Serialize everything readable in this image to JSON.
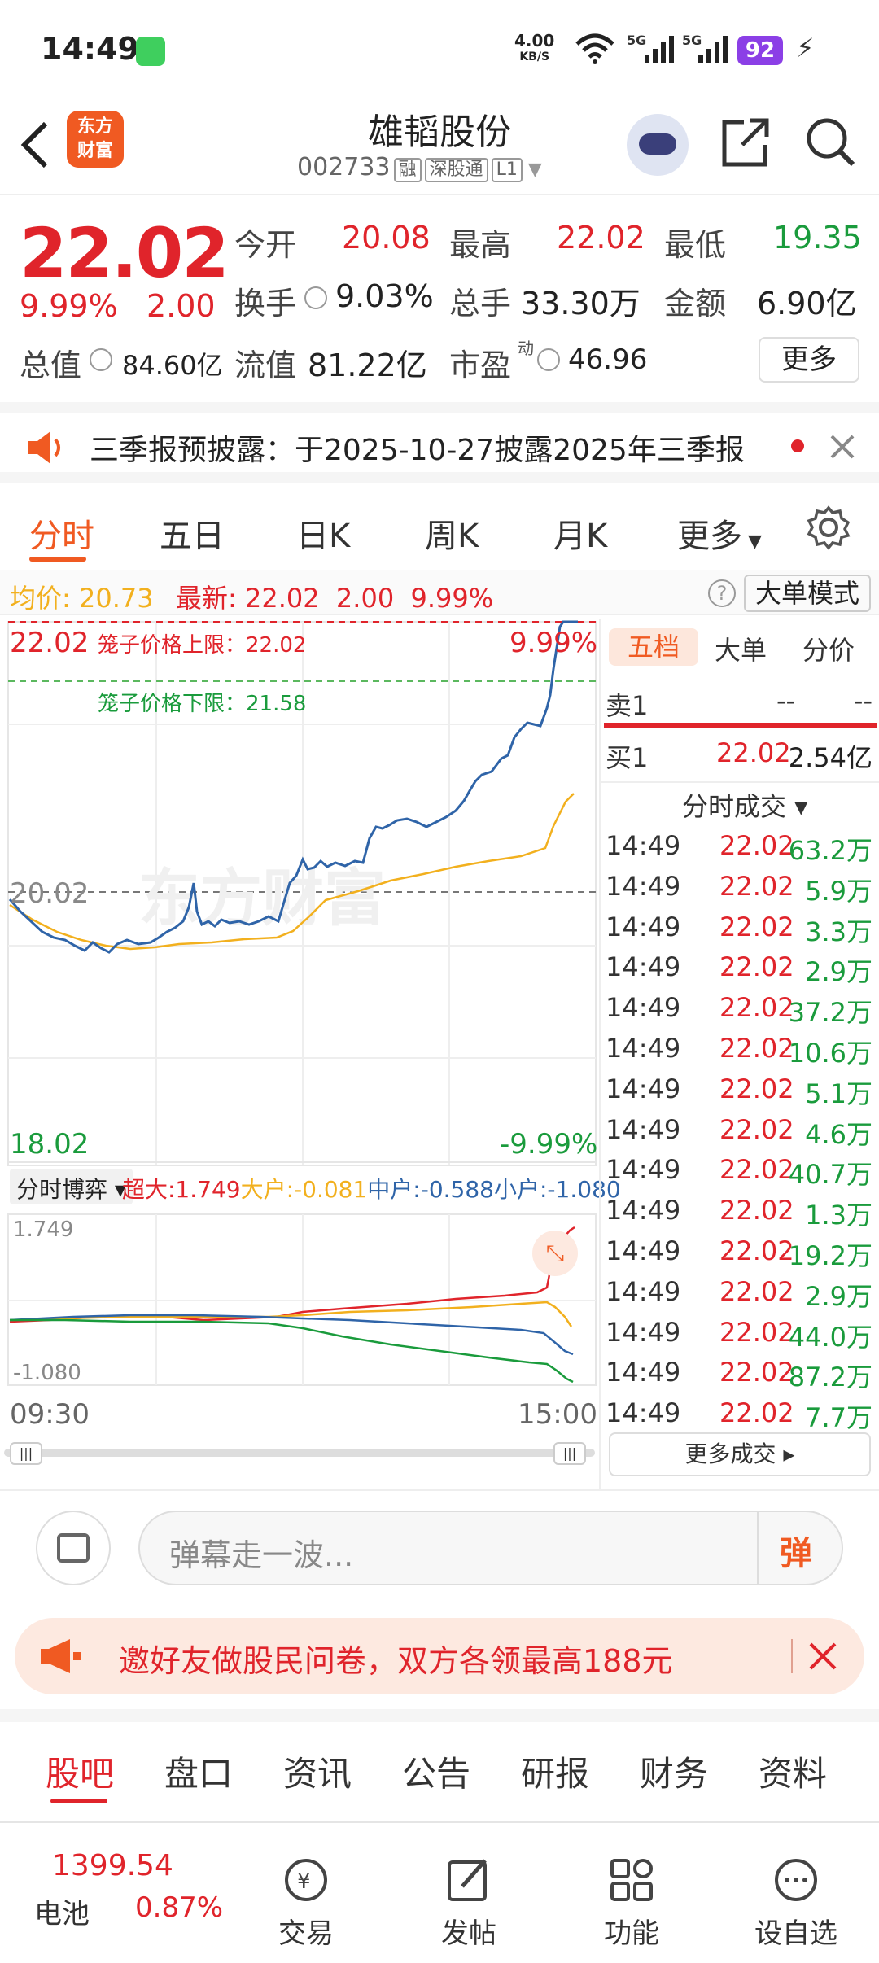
{
  "status": {
    "time": "14:49",
    "net_speed": "4.00",
    "net_unit": "KB/S",
    "sig1": "5G",
    "sig2": "5G",
    "battery": "92"
  },
  "header": {
    "logo_line1": "东方",
    "logo_line2": "财富",
    "title": "雄韬股份",
    "code": "002733",
    "tag1": "融",
    "tag2": "深股通",
    "tag3": "L1"
  },
  "quote": {
    "price": "22.02",
    "pct": "9.99%",
    "chg": "2.00",
    "open_label": "今开",
    "open": "20.08",
    "high_label": "最高",
    "high": "22.02",
    "low_label": "最低",
    "low": "19.35",
    "turnover_label": "换手",
    "turnover": "9.03%",
    "volume_label": "总手",
    "volume": "33.30万",
    "amount_label": "金额",
    "amount": "6.90亿",
    "mcap_label": "总值",
    "mcap": "84.60亿",
    "float_label": "流值",
    "float": "81.22亿",
    "pe_label": "市盈",
    "pe_sup": "动",
    "pe": "46.96",
    "more": "更多"
  },
  "notice": {
    "text": "三季报预披露：于2025-10-27披露2025年三季报"
  },
  "tabs": [
    "分时",
    "五日",
    "日K",
    "周K",
    "月K",
    "更多"
  ],
  "avgbar": {
    "avg_label": "均价:",
    "avg": "20.73",
    "latest_label": "最新:",
    "latest": "22.02",
    "chg": "2.00",
    "pct": "9.99%",
    "mode_btn": "大单模式"
  },
  "chart": {
    "top_price": "22.02",
    "top_pct": "9.99%",
    "cage_up": "笼子价格上限：22.02",
    "cage_down": "笼子价格下限：21.58",
    "mid": "20.02",
    "bottom_price": "18.02",
    "bottom_pct": "-9.99%",
    "watermark": "东方财富",
    "game_label": "分时博弈",
    "super": "超大:1.749",
    "big": "大户:-0.081",
    "mid_flow": "中户:-0.588",
    "small": "小户:-1.080",
    "flow_max": "1.749",
    "flow_min": "-1.080",
    "t_start": "09:30",
    "t_end": "15:00"
  },
  "colors": {
    "red": "#e0242b",
    "green": "#1a9b3c",
    "price_line": "#2f64a8",
    "avg_line": "#f2b01e",
    "accent": "#f05a22"
  },
  "right": {
    "tabs": [
      "五档",
      "大单",
      "分价"
    ],
    "sell1_label": "卖1",
    "sell1_price": "--",
    "sell1_vol": "--",
    "buy1_label": "买1",
    "buy1_price": "22.02",
    "buy1_vol": "2.54亿",
    "trades_title": "分时成交",
    "trades": [
      {
        "t": "14:49",
        "p": "22.02",
        "v": "63.2万"
      },
      {
        "t": "14:49",
        "p": "22.02",
        "v": "5.9万"
      },
      {
        "t": "14:49",
        "p": "22.02",
        "v": "3.3万"
      },
      {
        "t": "14:49",
        "p": "22.02",
        "v": "2.9万"
      },
      {
        "t": "14:49",
        "p": "22.02",
        "v": "37.2万"
      },
      {
        "t": "14:49",
        "p": "22.02",
        "v": "10.6万"
      },
      {
        "t": "14:49",
        "p": "22.02",
        "v": "5.1万"
      },
      {
        "t": "14:49",
        "p": "22.02",
        "v": "4.6万"
      },
      {
        "t": "14:49",
        "p": "22.02",
        "v": "40.7万"
      },
      {
        "t": "14:49",
        "p": "22.02",
        "v": "1.3万"
      },
      {
        "t": "14:49",
        "p": "22.02",
        "v": "19.2万"
      },
      {
        "t": "14:49",
        "p": "22.02",
        "v": "2.9万"
      },
      {
        "t": "14:49",
        "p": "22.02",
        "v": "44.0万"
      },
      {
        "t": "14:49",
        "p": "22.02",
        "v": "87.2万"
      },
      {
        "t": "14:49",
        "p": "22.02",
        "v": "7.7万"
      }
    ],
    "more_trades": "更多成交"
  },
  "danmu": {
    "placeholder": "弹幕走一波...",
    "send": "弹"
  },
  "promo": {
    "text": "邀好友做股民问卷，双方各领最高188元"
  },
  "bottom_tabs": [
    "股吧",
    "盘口",
    "资讯",
    "公告",
    "研报",
    "财务",
    "资料"
  ],
  "nav": {
    "index_value": "1399.54",
    "index_label": "电池",
    "index_pct": "0.87%",
    "trade": "交易",
    "post": "发帖",
    "func": "功能",
    "watch": "设自选"
  }
}
